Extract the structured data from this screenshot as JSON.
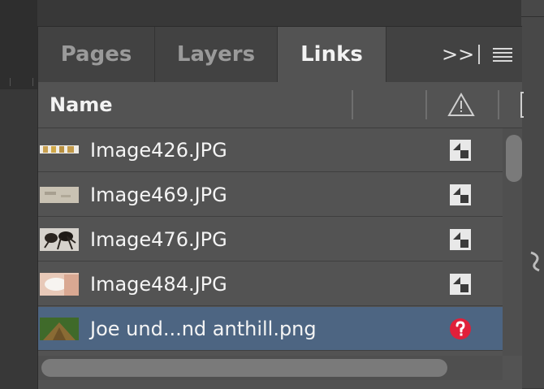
{
  "panel": {
    "tabs": [
      {
        "label": "Pages",
        "active": false
      },
      {
        "label": "Layers",
        "active": false
      },
      {
        "label": "Links",
        "active": true
      }
    ],
    "expand_label": ">>"
  },
  "columns": {
    "name_header": "Name",
    "warning_icon": "alert-triangle-icon"
  },
  "links": [
    {
      "filename": "Image426.JPG",
      "status_icon": "page-link-icon",
      "selected": false
    },
    {
      "filename": "Image469.JPG",
      "status_icon": "page-link-icon",
      "selected": false
    },
    {
      "filename": "Image476.JPG",
      "status_icon": "page-link-icon",
      "selected": false
    },
    {
      "filename": "Image484.JPG",
      "status_icon": "page-link-icon",
      "selected": false
    },
    {
      "filename": "Joe und...nd anthill.png",
      "status_icon": "missing-link-icon",
      "selected": true
    }
  ],
  "colors": {
    "selection": "#4d6582",
    "missing": "#e0203a"
  }
}
